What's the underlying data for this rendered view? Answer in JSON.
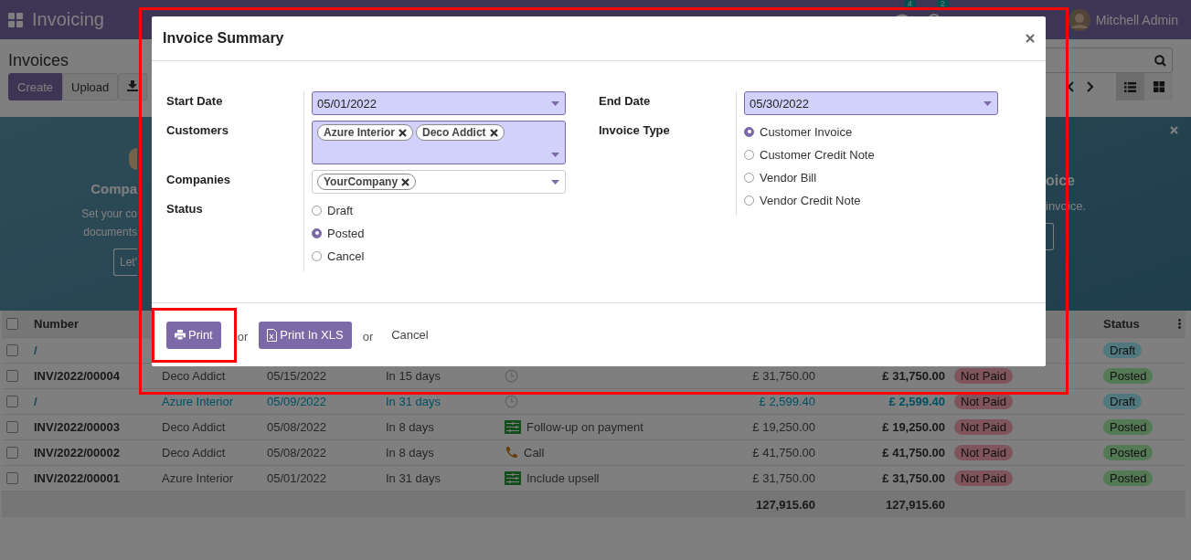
{
  "navbar": {
    "app_name": "Invoicing",
    "messages_count": "4",
    "activities_count": "2",
    "user": "Mitchell Admin"
  },
  "control_panel": {
    "title": "Invoices",
    "buttons": [
      "Create",
      "Upload"
    ],
    "views": [
      {
        "kind": "list",
        "selected": true
      },
      {
        "kind": "kanban",
        "selected": false
      }
    ]
  },
  "banner": {
    "left": {
      "title": "Compa",
      "lines": [
        "Set your co",
        "documents"
      ],
      "button": "Let'"
    },
    "right": {
      "title": "oice",
      "lines": [
        "invoice."
      ]
    }
  },
  "table": {
    "select_all": false,
    "headers": [
      "Number",
      "Status"
    ],
    "rows": [
      {
        "checked": false,
        "number": "/",
        "draft": true,
        "status": {
          "label": "Draft",
          "kind": "draft"
        }
      },
      {
        "checked": false,
        "number": "INV/2022/00004",
        "draft": false,
        "customer": "Deco Addict",
        "invoice_date": "05/15/2022",
        "due": "In 15 days",
        "activity": {
          "kind": "none"
        },
        "untaxed": "£ 31,750.00",
        "total": "£ 31,750.00",
        "payment": "Not Paid",
        "status": {
          "label": "Posted",
          "kind": "posted"
        }
      },
      {
        "checked": false,
        "number": "/",
        "draft": true,
        "customer": "Azure Interior",
        "invoice_date": "05/09/2022",
        "due": "In 31 days",
        "activity": {
          "kind": "none"
        },
        "untaxed": "£ 2,599.40",
        "total": "£ 2,599.40",
        "payment": "Not Paid",
        "status": {
          "label": "Draft",
          "kind": "draft"
        }
      },
      {
        "checked": false,
        "number": "INV/2022/00003",
        "draft": false,
        "customer": "Deco Addict",
        "invoice_date": "05/08/2022",
        "due": "In 8 days",
        "activity": {
          "kind": "todo",
          "text": "Follow-up on payment"
        },
        "untaxed": "£ 19,250.00",
        "total": "£ 19,250.00",
        "payment": "Not Paid",
        "status": {
          "label": "Posted",
          "kind": "posted"
        }
      },
      {
        "checked": false,
        "number": "INV/2022/00002",
        "draft": false,
        "customer": "Deco Addict",
        "invoice_date": "05/08/2022",
        "due": "In 8 days",
        "activity": {
          "kind": "call",
          "text": "Call"
        },
        "untaxed": "£ 41,750.00",
        "total": "£ 41,750.00",
        "payment": "Not Paid",
        "status": {
          "label": "Posted",
          "kind": "posted"
        }
      },
      {
        "checked": false,
        "number": "INV/2022/00001",
        "draft": false,
        "customer": "Azure Interior",
        "invoice_date": "05/01/2022",
        "due": "In 31 days",
        "activity": {
          "kind": "todo",
          "text": "Include upsell"
        },
        "untaxed": "£ 31,750.00",
        "total": "£ 31,750.00",
        "payment": "Not Paid",
        "status": {
          "label": "Posted",
          "kind": "posted"
        }
      }
    ],
    "totals": {
      "untaxed": "127,915.60",
      "total": "127,915.60"
    }
  },
  "dialog": {
    "title": "Invoice Summary",
    "start_date": {
      "label": "Start Date",
      "value": "05/01/2022"
    },
    "customers": {
      "label": "Customers",
      "tags": [
        "Azure Interior",
        "Deco Addict"
      ]
    },
    "companies": {
      "label": "Companies",
      "tags": [
        "YourCompany"
      ]
    },
    "status": {
      "label": "Status",
      "options": [
        {
          "label": "Draft",
          "selected": false
        },
        {
          "label": "Posted",
          "selected": true
        },
        {
          "label": "Cancel",
          "selected": false
        }
      ]
    },
    "end_date": {
      "label": "End Date",
      "value": "05/30/2022"
    },
    "invoice_type": {
      "label": "Invoice Type",
      "options": [
        {
          "label": "Customer Invoice",
          "selected": true
        },
        {
          "label": "Customer Credit Note",
          "selected": false
        },
        {
          "label": "Vendor Bill",
          "selected": false
        },
        {
          "label": "Vendor Credit Note",
          "selected": false
        }
      ]
    },
    "footer": [
      {
        "kind": "print",
        "label": "Print"
      },
      {
        "kind": "text",
        "label": "or"
      },
      {
        "kind": "xls",
        "label": "Print In XLS"
      },
      {
        "kind": "text",
        "label": "or"
      },
      {
        "kind": "link",
        "label": "Cancel"
      }
    ]
  }
}
